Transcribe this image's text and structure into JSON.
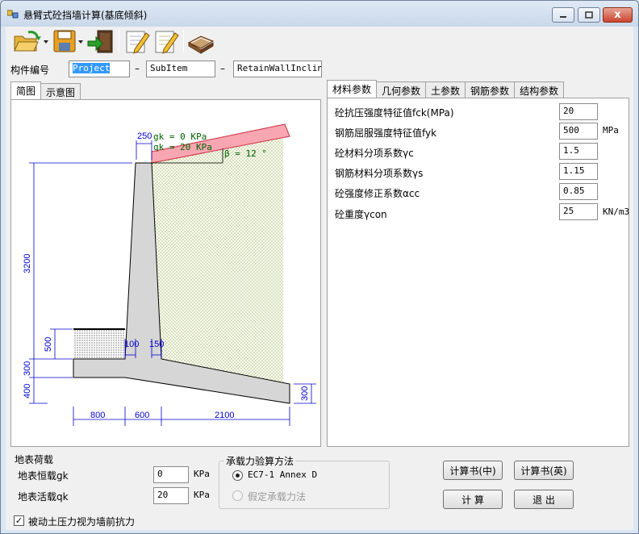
{
  "window": {
    "title": "悬臂式砼挡墙计算(基底倾斜)",
    "close_glyph": "x"
  },
  "icons": {
    "toolbar": [
      "open-folder-icon",
      "save-icon",
      "exit-door-icon",
      "edit-note-icon",
      "edit-note-2-icon",
      "book-icon"
    ]
  },
  "component": {
    "label": "构件编号",
    "project": "Project",
    "sep1": "–",
    "subitem": "SubItem",
    "sep2": "–",
    "name": "RetainWallIncline",
    "name_cursor": "‹"
  },
  "left_tabs": [
    "简图",
    "示意图"
  ],
  "right_tabs": [
    "材料参数",
    "几何参数",
    "土参数",
    "钢筋参数",
    "结构参数"
  ],
  "material": {
    "rows": [
      {
        "label": "砼抗压强度特征值fck(MPa)",
        "value": "20",
        "unit": ""
      },
      {
        "label": "钢筋屈服强度特征值fyk",
        "value": "500",
        "unit": "MPa"
      },
      {
        "label": "砼材料分项系数γc",
        "value": "1.5",
        "unit": ""
      },
      {
        "label": "钢筋材料分项系数γs",
        "value": "1.15",
        "unit": ""
      },
      {
        "label": "砼强度修正系数αcc",
        "value": "0.85",
        "unit": ""
      },
      {
        "label": "砼重度γcon",
        "value": "25",
        "unit": "KN/m3"
      }
    ]
  },
  "diagram": {
    "gk_label": "gk = 0 KPa",
    "qk_label": "qk = 20 KPa",
    "beta_label": "β = 12 °",
    "dims": {
      "top_width": "250",
      "wall_height": "3200",
      "front_soil": "500",
      "toe_thk": "300",
      "base_thk": "400",
      "heel_end": "300",
      "stem_front": "100",
      "stem_back": "150",
      "toe_len": "800",
      "stem_len": "600",
      "heel_len": "2100"
    }
  },
  "surface_load": {
    "title": "地表荷载",
    "dead_label": "地表恒载gk",
    "dead_value": "0",
    "live_label": "地表活载qk",
    "live_value": "20",
    "unit": "KPa"
  },
  "bearing": {
    "title": "承载力验算方法",
    "option1": "EC7-1 Annex D",
    "option2": "假定承载力法"
  },
  "buttons": {
    "report_cn": "计算书(中)",
    "report_en": "计算书(英)",
    "calc": "计  算",
    "exit": "退  出"
  },
  "passive": {
    "check": "✓",
    "label": "被动土压力视为墙前抗力"
  }
}
